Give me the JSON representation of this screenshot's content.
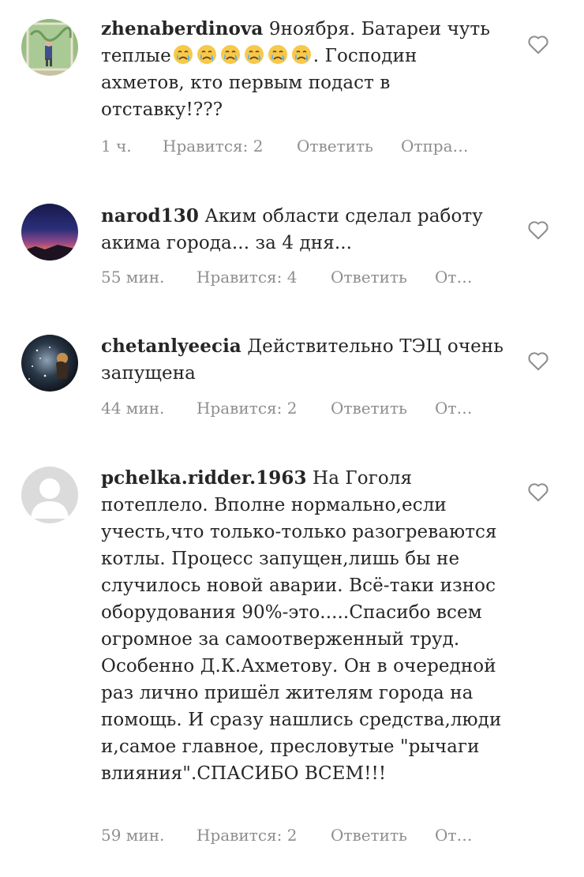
{
  "comments": [
    {
      "username": "zhenaberdinova",
      "text_before": "9ноября. Батареи чуть теплые",
      "emoji_count": 6,
      "emoji": "crying-face",
      "text_after": ". Господин ахметов, кто первым подаст в отставку!???",
      "time": "1 ч.",
      "likes": "Нравится: 2",
      "reply": "Ответить",
      "send": "Отпра…"
    },
    {
      "username": "narod130",
      "text": "Аким области сделал работу акима города... за 4 дня...",
      "time": "55 мин.",
      "likes": "Нравится: 4",
      "reply": "Ответить",
      "send": "От…"
    },
    {
      "username": "chetanlyeecia",
      "text": "Действительно ТЭЦ очень запущена",
      "time": "44 мин.",
      "likes": "Нравится: 2",
      "reply": "Ответить",
      "send": "От…"
    },
    {
      "username": "pchelka.ridder.1963",
      "text": "На Гоголя потеплело. Вполне нормально,если учесть,что только-только разогреваются котлы. Процесс запущен,лишь бы не случилось новой аварии. Всё-таки износ оборудования 90%-это.....Спасибо всем огромное за самоотверженный труд. Особенно Д.К.Ахметову. Он в очередной раз лично пришёл жителям города на помощь. И сразу нашлись средства,люди и,самое главное, пресловутые \"рычаги влияния\".СПАСИБО ВСЕМ!!!",
      "time": "59 мин.",
      "likes": "Нравится: 2",
      "reply": "Ответить",
      "send": "От…"
    }
  ],
  "colors": {
    "text": "#262626",
    "meta": "#8e8e8e",
    "heart": "#8e8e8e"
  },
  "icons": {
    "like": "heart-outline-icon"
  }
}
